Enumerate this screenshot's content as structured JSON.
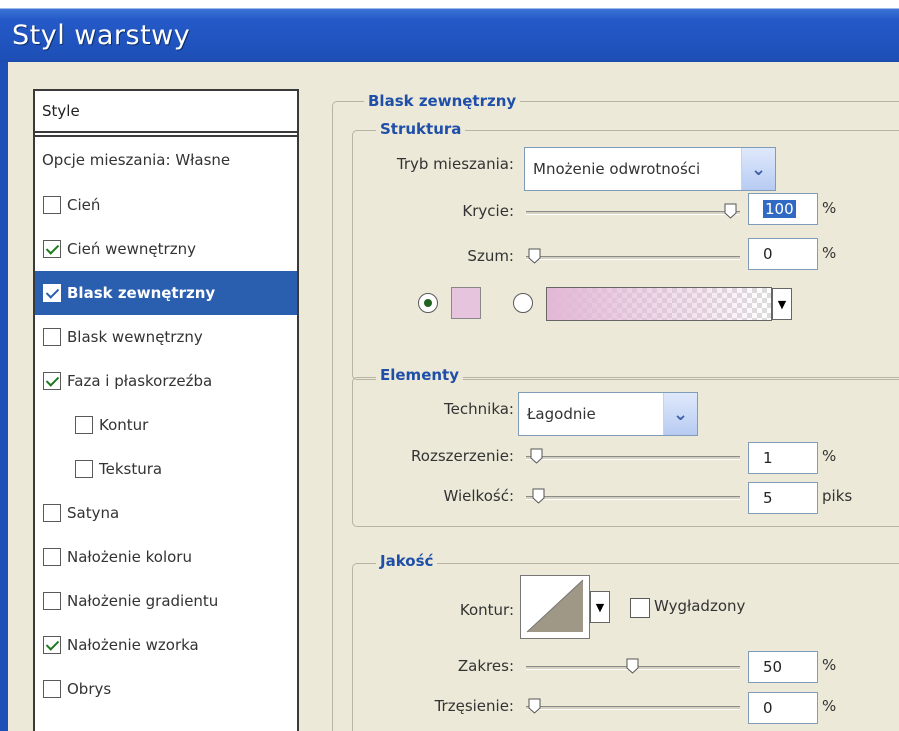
{
  "window": {
    "title": "Styl warstwy"
  },
  "styles_list": {
    "header": "Style",
    "blending": "Opcje mieszania: Własne",
    "items": [
      {
        "label": "Cień",
        "checked": false,
        "indent": false,
        "selected": false
      },
      {
        "label": "Cień wewnętrzny",
        "checked": true,
        "indent": false,
        "selected": false
      },
      {
        "label": "Blask zewnętrzny",
        "checked": true,
        "indent": false,
        "selected": true
      },
      {
        "label": "Blask wewnętrzny",
        "checked": false,
        "indent": false,
        "selected": false
      },
      {
        "label": "Faza i płaskorzeźba",
        "checked": true,
        "indent": false,
        "selected": false
      },
      {
        "label": "Kontur",
        "checked": false,
        "indent": true,
        "selected": false
      },
      {
        "label": "Tekstura",
        "checked": false,
        "indent": true,
        "selected": false
      },
      {
        "label": "Satyna",
        "checked": false,
        "indent": false,
        "selected": false
      },
      {
        "label": "Nałożenie koloru",
        "checked": false,
        "indent": false,
        "selected": false
      },
      {
        "label": "Nałożenie gradientu",
        "checked": false,
        "indent": false,
        "selected": false
      },
      {
        "label": "Nałożenie wzorka",
        "checked": true,
        "indent": false,
        "selected": false
      },
      {
        "label": "Obrys",
        "checked": false,
        "indent": false,
        "selected": false
      }
    ]
  },
  "outer_glow": {
    "title": "Blask zewnętrzny",
    "structure": {
      "title": "Struktura",
      "blend_mode_label": "Tryb mieszania:",
      "blend_mode_value": "Mnożenie odwrotności",
      "opacity_label": "Krycie:",
      "opacity_value": "100",
      "opacity_fraction": 1.0,
      "opacity_unit": "%",
      "noise_label": "Szum:",
      "noise_value": "0",
      "noise_fraction": 0.0,
      "noise_unit": "%",
      "solid_color": "#e6c4dd",
      "gradient_from": "#e2b8d6",
      "use_solid_color": true
    },
    "elements": {
      "title": "Elementy",
      "technique_label": "Technika:",
      "technique_value": "Łagodnie",
      "spread_label": "Rozszerzenie:",
      "spread_value": "1",
      "spread_fraction": 0.01,
      "spread_unit": "%",
      "size_label": "Wielkość:",
      "size_value": "5",
      "size_fraction": 0.02,
      "size_unit": "piks"
    },
    "quality": {
      "title": "Jakość",
      "contour_label": "Kontur:",
      "antialiased_label": "Wygładzony",
      "antialiased_checked": false,
      "range_label": "Zakres:",
      "range_value": "50",
      "range_fraction": 0.5,
      "range_unit": "%",
      "jitter_label": "Trzęsienie:",
      "jitter_value": "0",
      "jitter_fraction": 0.0,
      "jitter_unit": "%"
    }
  },
  "colors": {
    "accent": "#2a5fb0",
    "title_bar": "#1d4fb6",
    "section_title": "#1f4fa8"
  }
}
